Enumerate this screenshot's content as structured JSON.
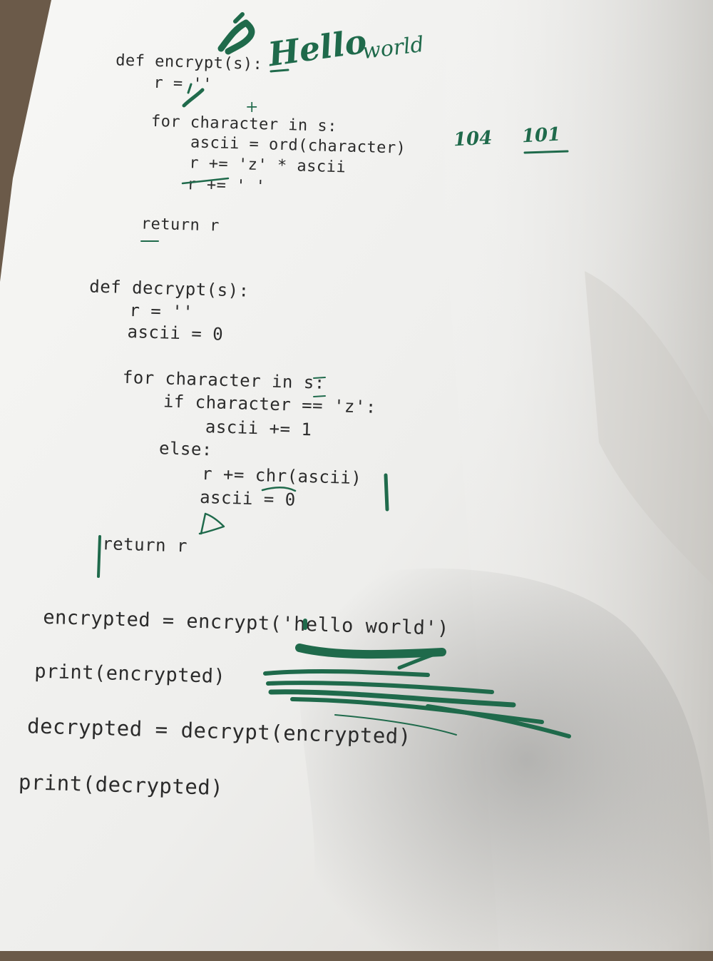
{
  "code": {
    "encrypt": [
      "def encrypt(s):",
      "r = ''",
      "for character in s:",
      "ascii = ord(character)",
      "r += 'z' * ascii",
      "r += ' '",
      "return r"
    ],
    "decrypt": [
      "def decrypt(s):",
      "r = ''",
      "ascii = 0",
      "for character in s:",
      "if character == 'z':",
      "ascii += 1",
      "else:",
      "r += chr(ascii)",
      "ascii = 0",
      "return r"
    ],
    "main": [
      "encrypted = encrypt('hello world')",
      "print(encrypted)",
      "decrypted = decrypt(encrypted)",
      "print(decrypted)"
    ]
  },
  "handwriting": {
    "hello": "Hello",
    "world": "world",
    "num_a": "104",
    "num_b": "101",
    "plus": "+"
  },
  "colors": {
    "ink": "#1f6a4b",
    "paper": "#f3f3f1",
    "text": "#2b2b2b",
    "table": "#6b5a49"
  }
}
